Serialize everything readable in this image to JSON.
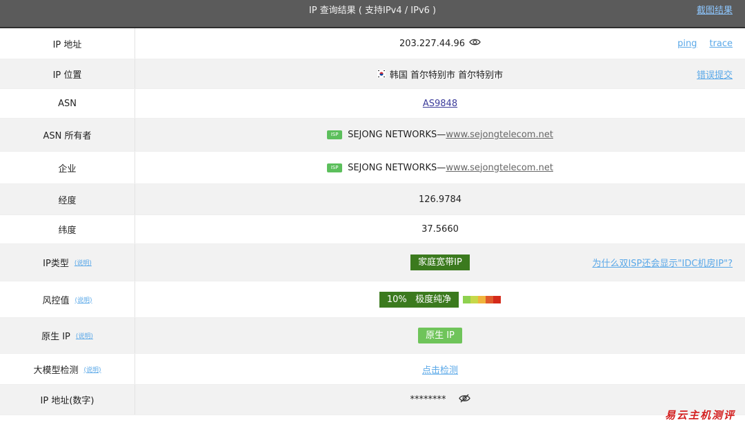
{
  "header": {
    "title": "IP 查询结果 ( 支持IPv4 / IPv6 )",
    "screenshot_link": "截图结果"
  },
  "rows": {
    "ip": {
      "label": "IP 地址",
      "value": "203.227.44.96",
      "ping": "ping",
      "trace": "trace"
    },
    "location": {
      "label": "IP 位置",
      "value": "韩国 首尔特别市 首尔特别市",
      "report": "错误提交"
    },
    "asn": {
      "label": "ASN",
      "value": "AS9848"
    },
    "asn_owner": {
      "label": "ASN 所有者",
      "badge": "ISP",
      "name": "SEJONG NETWORKS—",
      "site": "www.sejongtelecom.net"
    },
    "company": {
      "label": "企业",
      "badge": "ISP",
      "name": "SEJONG NETWORKS—",
      "site": "www.sejongtelecom.net"
    },
    "longitude": {
      "label": "经度",
      "value": "126.9784"
    },
    "latitude": {
      "label": "纬度",
      "value": "37.5660"
    },
    "ip_type": {
      "label": "IP类型",
      "hint": "(说明)",
      "value": "家庭宽带IP",
      "why": "为什么双ISP还会显示\"IDC机房IP\"?"
    },
    "risk": {
      "label": "风控值",
      "hint": "(说明)",
      "score": "10%",
      "level": "极度纯净",
      "bar_colors": [
        "#8fd14f",
        "#c6d84a",
        "#f0b43c",
        "#e05a2b",
        "#d42a1a"
      ]
    },
    "native": {
      "label": "原生 IP",
      "hint": "(说明)",
      "value": "原生 IP"
    },
    "llm": {
      "label": "大模型检测",
      "hint": "(说明)",
      "value": "点击检测"
    },
    "ip_number": {
      "label": "IP 地址(数字)",
      "value": "********"
    }
  },
  "watermark": "易云主机测评",
  "colors": {
    "header_bg": "#5b5b5b",
    "alt_row": "#f2f2f2",
    "green_dark": "#3b7a1e",
    "green_light": "#6fc45a",
    "link": "#5aa8e8"
  },
  "icons": {
    "ip_eye": "eye-icon",
    "number_eye": "eye-off-icon",
    "flag": "korea-flag-icon"
  }
}
